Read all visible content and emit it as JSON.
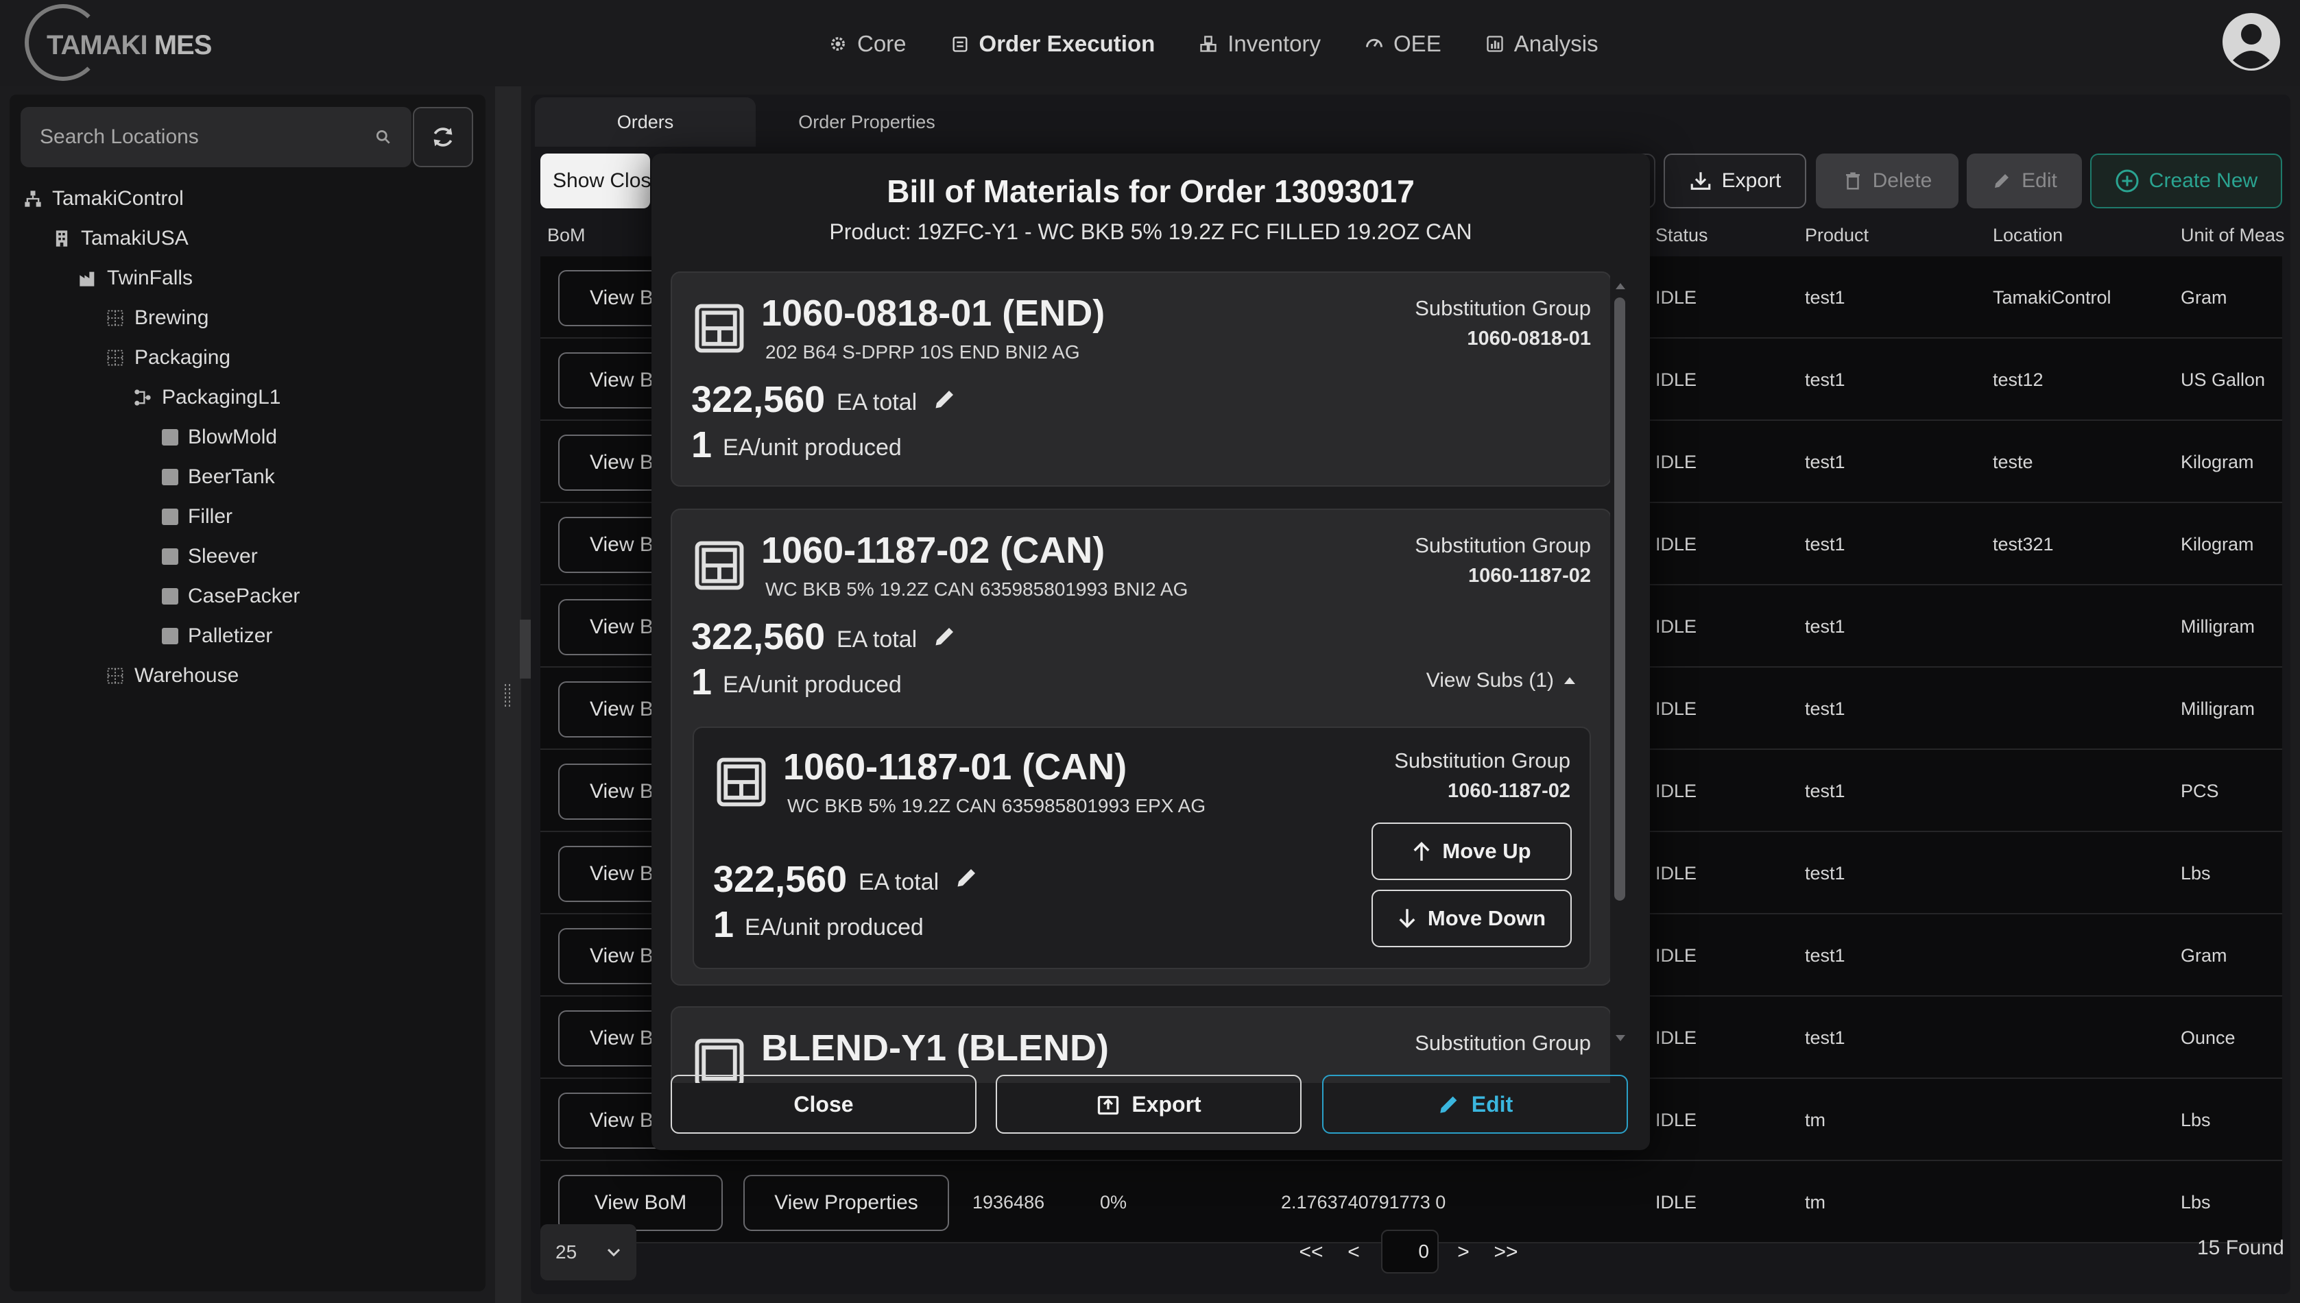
{
  "app": {
    "logo_text_light": "TAMAKI",
    "logo_text_bold": "MES"
  },
  "nav": [
    {
      "label": "Core",
      "icon": "gear-icon"
    },
    {
      "label": "Order Execution",
      "icon": "clipboard-icon"
    },
    {
      "label": "Inventory",
      "icon": "boxes-icon"
    },
    {
      "label": "OEE",
      "icon": "gauge-icon"
    },
    {
      "label": "Analysis",
      "icon": "chart-icon"
    }
  ],
  "sidebar": {
    "search_placeholder": "Search Locations",
    "tree": [
      {
        "label": "TamakiControl",
        "icon": "hierarchy-icon"
      },
      {
        "label": "TamakiUSA",
        "icon": "building-icon"
      },
      {
        "label": "TwinFalls",
        "icon": "factory-icon"
      },
      {
        "label": "Brewing",
        "icon": "area-icon"
      },
      {
        "label": "Packaging",
        "icon": "area-icon"
      },
      {
        "label": "PackagingL1",
        "icon": "line-icon"
      },
      {
        "label": "BlowMold",
        "icon": "cell-icon"
      },
      {
        "label": "BeerTank",
        "icon": "cell-icon"
      },
      {
        "label": "Filler",
        "icon": "cell-icon"
      },
      {
        "label": "Sleever",
        "icon": "cell-icon"
      },
      {
        "label": "CasePacker",
        "icon": "cell-icon"
      },
      {
        "label": "Palletizer",
        "icon": "cell-icon"
      },
      {
        "label": "Warehouse",
        "icon": "area-icon"
      }
    ]
  },
  "main": {
    "tabs": [
      "Orders",
      "Order Properties"
    ],
    "show_closed_label": "Show Clos",
    "toolbar": {
      "export": "Export",
      "delete": "Delete",
      "edit": "Edit",
      "create": "Create New"
    },
    "columns": {
      "bom": "BoM",
      "status": "Status",
      "product": "Product",
      "location": "Location",
      "uom": "Unit of Meas"
    },
    "view_bom_label": "View B",
    "view_bom_full": "View BoM",
    "view_properties": "View Properties",
    "rows": [
      {
        "status": "IDLE",
        "product": "test1",
        "location": "TamakiControl",
        "uom": "Gram"
      },
      {
        "status": "IDLE",
        "product": "test1",
        "location": "test12",
        "uom": "US Gallon"
      },
      {
        "status": "IDLE",
        "product": "test1",
        "location": "teste",
        "uom": "Kilogram"
      },
      {
        "status": "IDLE",
        "product": "test1",
        "location": "test321",
        "uom": "Kilogram"
      },
      {
        "status": "IDLE",
        "product": "test1",
        "location": "",
        "uom": "Milligram"
      },
      {
        "status": "IDLE",
        "product": "test1",
        "location": "",
        "uom": "Milligram"
      },
      {
        "status": "IDLE",
        "product": "test1",
        "location": "",
        "uom": "PCS"
      },
      {
        "status": "IDLE",
        "product": "test1",
        "location": "",
        "uom": "Lbs"
      },
      {
        "status": "IDLE",
        "product": "test1",
        "location": "",
        "uom": "Gram"
      },
      {
        "status": "IDLE",
        "product": "test1",
        "location": "",
        "uom": "Ounce"
      },
      {
        "status": "IDLE",
        "product": "tm",
        "location": "",
        "uom": "Lbs"
      }
    ],
    "partial_row": {
      "order": "1936486",
      "pct": "0%",
      "qty": "2.1763740791773  0",
      "status": "IDLE",
      "product": "tm",
      "uom": "Lbs"
    },
    "pagination": {
      "page_size": "25",
      "first": "<<",
      "prev": "<",
      "page": "0",
      "next": ">",
      "last": ">>",
      "found": "15 Found"
    }
  },
  "modal": {
    "title": "Bill of Materials for Order 13093017",
    "subtitle": "Product: 19ZFC-Y1 - WC BKB 5% 19.2Z FC FILLED 19.2OZ CAN",
    "sg_label": "Substitution Group",
    "ea_total": "EA total",
    "ea_per": "EA/unit produced",
    "items": [
      {
        "part": "1060-0818-01 (END)",
        "desc": "202 B64 S-DPRP 10S END BNI2 AG",
        "total": "322,560",
        "per": "1",
        "sg": "1060-0818-01"
      },
      {
        "part": "1060-1187-02 (CAN)",
        "desc": "WC BKB 5% 19.2Z CAN 635985801993 BNI2 AG",
        "total": "322,560",
        "per": "1",
        "sg": "1060-1187-02",
        "view_subs": "View Subs (1)"
      },
      {
        "part": "BLEND-Y1 (BLEND)",
        "sg_label": "Substitution Group"
      }
    ],
    "sub": {
      "part": "1060-1187-01 (CAN)",
      "desc": "WC BKB 5% 19.2Z CAN 635985801993 EPX AG",
      "total": "322,560",
      "per": "1",
      "sg": "1060-1187-02",
      "move_up": "Move Up",
      "move_down": "Move Down"
    },
    "footer": {
      "close": "Close",
      "export": "Export",
      "edit": "Edit"
    }
  }
}
